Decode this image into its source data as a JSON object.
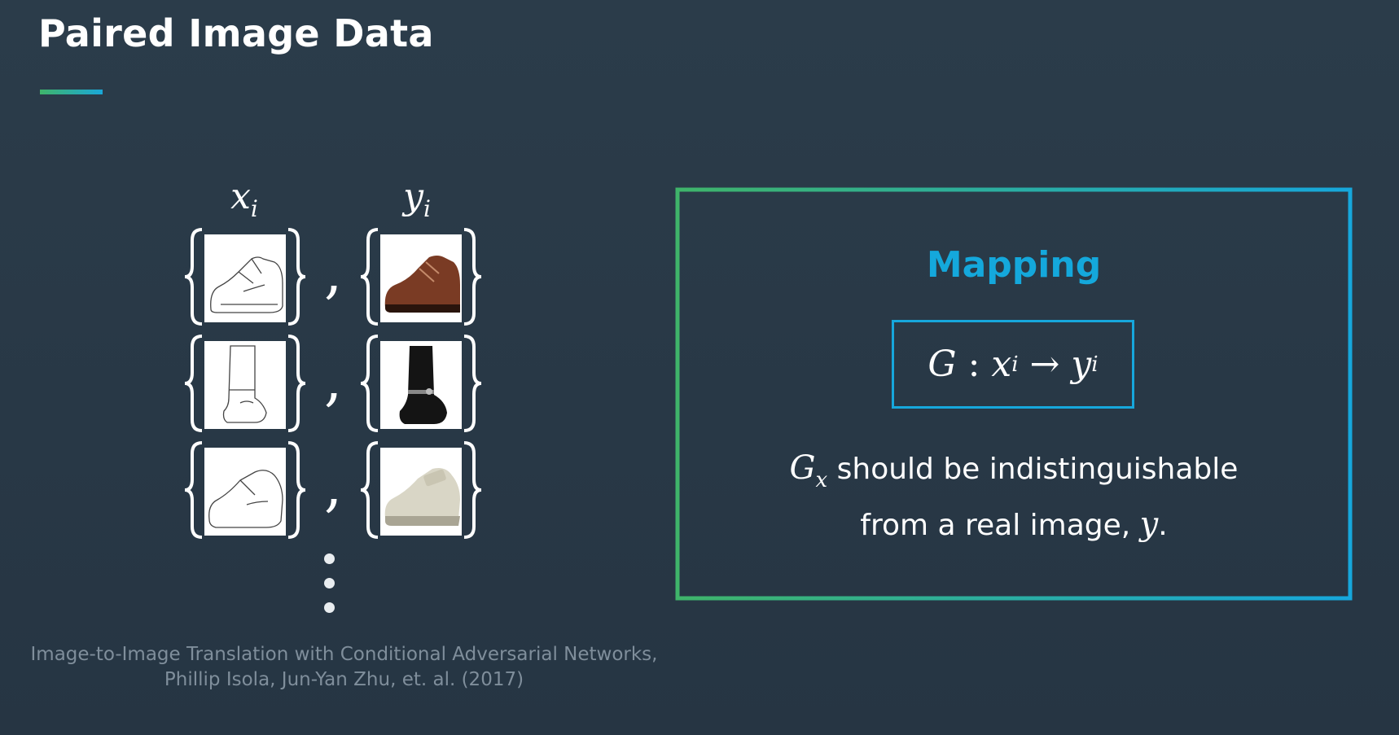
{
  "slide": {
    "title": "Paired Image Data",
    "accent_gradient": [
      "#3fb46a",
      "#1aa7d8"
    ]
  },
  "pairs": {
    "x_label": "x",
    "x_sub": "i",
    "y_label": "y",
    "y_sub": "i",
    "rows": [
      {
        "sketch": "oxford-shoe-sketch",
        "photo": "brown-oxford-shoe-photo"
      },
      {
        "sketch": "boot-sketch",
        "photo": "black-biker-boot-photo"
      },
      {
        "sketch": "velcro-shoe-sketch",
        "photo": "beige-velcro-shoe-photo"
      }
    ],
    "separator": ",",
    "continuation": "⋮"
  },
  "citation": {
    "line1": "Image-to-Image Translation with Conditional Adversarial Networks,",
    "line2": "Phillip Isola, Jun-Yan Zhu, et. al. (2017)"
  },
  "mapping": {
    "title": "Mapping",
    "title_color": "#14a8dc",
    "formula_G": "G",
    "formula_colon": " : ",
    "formula_x": "x",
    "formula_x_sub": "i",
    "formula_arrow": " → ",
    "formula_y": "y",
    "formula_y_sub": "i",
    "desc_G": "G",
    "desc_G_sub": "x",
    "desc_text1": " should be indistinguishable",
    "desc_text2": "from a real image, ",
    "desc_y": "y",
    "desc_end": "."
  }
}
